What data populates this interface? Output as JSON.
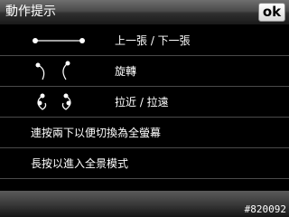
{
  "header": {
    "title": "動作提示",
    "ok_label": "ok"
  },
  "rows": [
    {
      "label": "上一張 / 下一張",
      "gesture_icon": "swipe-horizontal-icon"
    },
    {
      "label": "旋轉",
      "gesture_icon": "rotate-gesture-icon"
    },
    {
      "label": "拉近 / 拉遠",
      "gesture_icon": "pinch-zoom-icon"
    },
    {
      "label": "連按兩下以便切換為全螢幕"
    },
    {
      "label": "長按以進入全景模式"
    }
  ],
  "footer": {
    "serial": "#820092"
  },
  "colors": {
    "background": "#000000",
    "divider": "#4a4a4a"
  }
}
